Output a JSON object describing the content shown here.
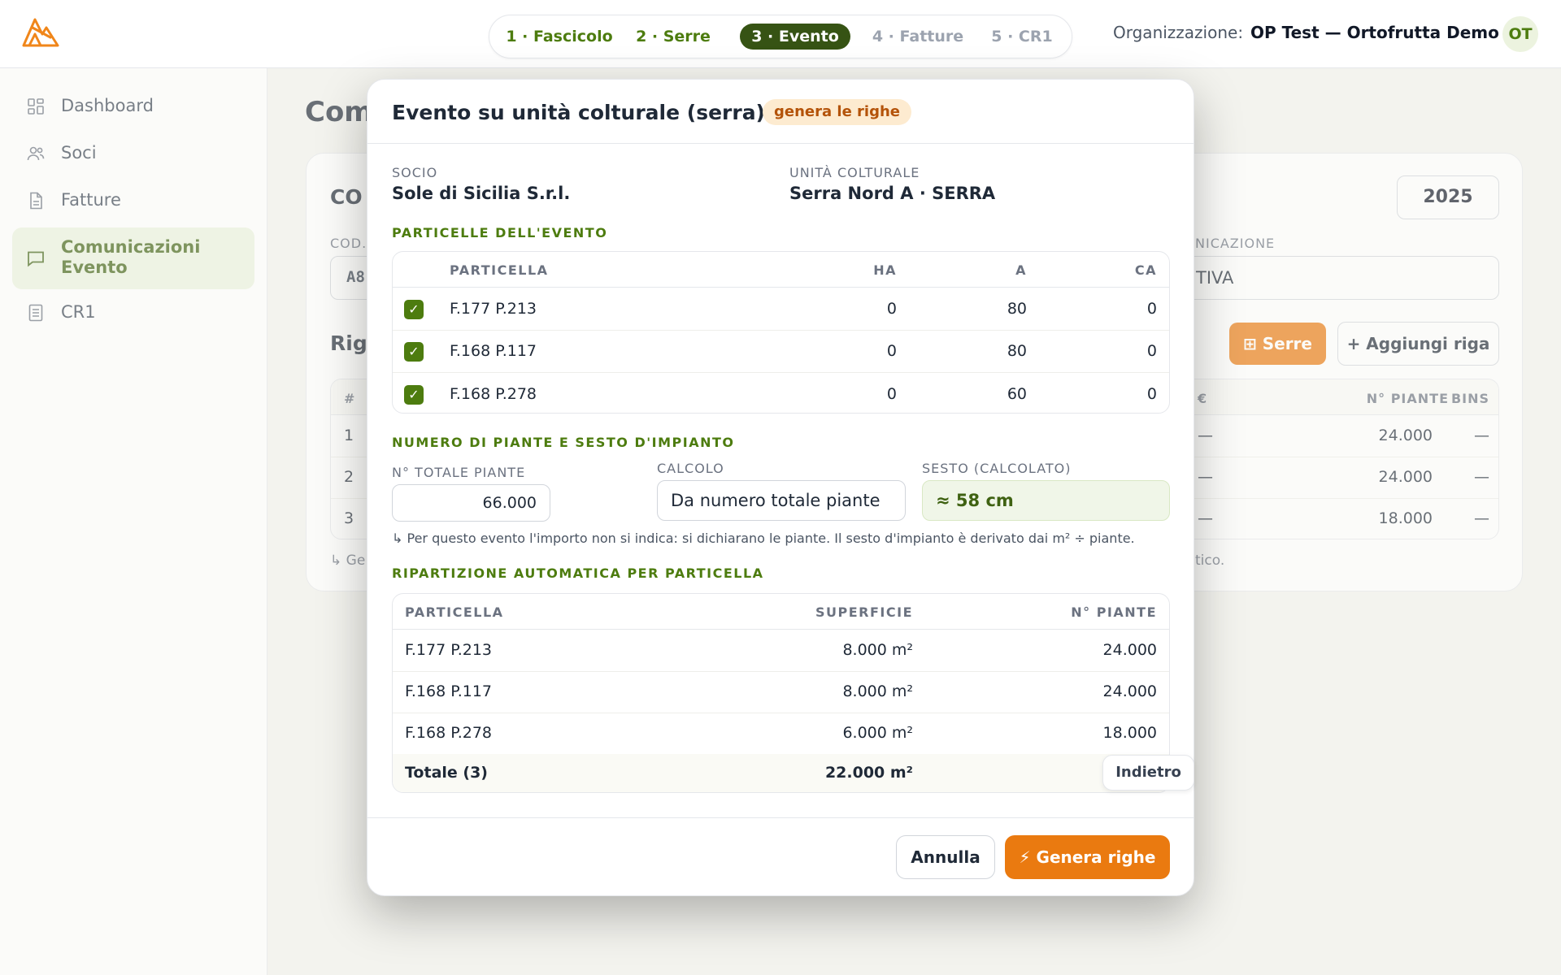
{
  "header": {
    "steps": [
      {
        "label": "1 · Fascicolo",
        "state": "done"
      },
      {
        "label": "2 · Serre",
        "state": "done"
      },
      {
        "label": "3 · Evento",
        "state": "active"
      },
      {
        "label": "4 · Fatture",
        "state": "todo"
      },
      {
        "label": "5 · CR1",
        "state": "todo"
      }
    ],
    "org_label": "Organizzazione:",
    "org_name": "OP Test — Ortofrutta Demo",
    "avatar": "OT"
  },
  "sidebar": {
    "items": [
      {
        "label": "Dashboard",
        "icon": "dashboard-icon"
      },
      {
        "label": "Soci",
        "icon": "users-icon"
      },
      {
        "label": "Fatture",
        "icon": "document-icon"
      },
      {
        "label": "Comunicazioni Evento",
        "icon": "message-icon",
        "active": true
      },
      {
        "label": "CR1",
        "icon": "list-document-icon"
      }
    ]
  },
  "background": {
    "page_title": "Com",
    "card_title": "CO",
    "cod_label": "COD.",
    "cod_value": "A8",
    "comm_label": "NICAZIONE",
    "comm_value": "TIVA",
    "year": "2025",
    "rows_title": "Rig",
    "serre_button": "⊞ Serre",
    "add_row_button": "+ Aggiungi riga",
    "table": {
      "headers": {
        "num": "#",
        "euro": "€",
        "piante": "N° PIANTE",
        "bins": "BINS"
      },
      "rows": [
        {
          "num": "1",
          "euro": "—",
          "piante": "24.000",
          "bins": "—"
        },
        {
          "num": "2",
          "euro": "—",
          "piante": "24.000",
          "bins": "—"
        },
        {
          "num": "3",
          "euro": "—",
          "piante": "18.000",
          "bins": "—"
        }
      ]
    },
    "footnote_left": "↳ Ge",
    "footnote_right": "tico."
  },
  "modal": {
    "title": "Evento su unità colturale (serra)",
    "badge": "genera le righe",
    "socio_label": "SOCIO",
    "socio_value": "Sole di Sicilia S.r.l.",
    "unita_label": "UNITÀ COLTURALE",
    "unita_value": "Serra Nord A · SERRA",
    "particelle_title": "PARTICELLE DELL'EVENTO",
    "particelle_headers": {
      "particella": "PARTICELLA",
      "ha": "HA",
      "a": "A",
      "ca": "CA"
    },
    "particelle": [
      {
        "checked": true,
        "name": "F.177 P.213",
        "ha": "0",
        "a": "80",
        "ca": "0"
      },
      {
        "checked": true,
        "name": "F.168 P.117",
        "ha": "0",
        "a": "80",
        "ca": "0"
      },
      {
        "checked": true,
        "name": "F.168 P.278",
        "ha": "0",
        "a": "60",
        "ca": "0"
      }
    ],
    "piante_title": "NUMERO DI PIANTE E SESTO D'IMPIANTO",
    "totale_label": "N° TOTALE PIANTE",
    "totale_value": "66.000",
    "calcolo_label": "CALCOLO",
    "calcolo_value": "Da numero totale piante",
    "sesto_label": "SESTO (CALCOLATO)",
    "sesto_value": "≈ 58 cm",
    "hint": "↳ Per questo evento l'importo non si indica: si dichiarano le piante. Il sesto d'impianto è derivato dai m² ÷ piante.",
    "ripartizione_title": "RIPARTIZIONE AUTOMATICA PER PARTICELLA",
    "ripartizione_headers": {
      "particella": "PARTICELLA",
      "superficie": "SUPERFICIE",
      "piante": "N° PIANTE"
    },
    "ripartizione": [
      {
        "name": "F.177 P.213",
        "superficie": "8.000 m²",
        "piante": "24.000"
      },
      {
        "name": "F.168 P.117",
        "superficie": "8.000 m²",
        "piante": "24.000"
      },
      {
        "name": "F.168 P.278",
        "superficie": "6.000 m²",
        "piante": "18.000"
      }
    ],
    "totale_row": {
      "label": "Totale (3)",
      "superficie": "22.000 m²",
      "piante": "6"
    },
    "indietro_button": "Indietro",
    "annulla_button": "Annulla",
    "genera_button": "⚡ Genera righe"
  },
  "colors": {
    "accent_orange": "#ea7a10",
    "accent_green": "#4d7c0f",
    "active_step": "#365314"
  }
}
